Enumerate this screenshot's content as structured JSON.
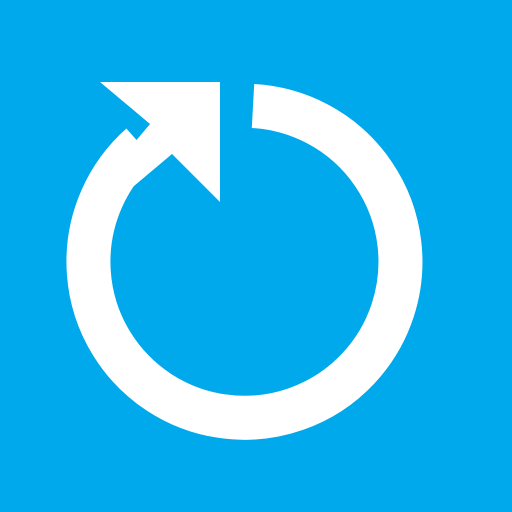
{
  "tile": {
    "background_color": "#00A8EC"
  },
  "icon": {
    "name": "refresh-icon",
    "color": "#FFFFFF"
  }
}
